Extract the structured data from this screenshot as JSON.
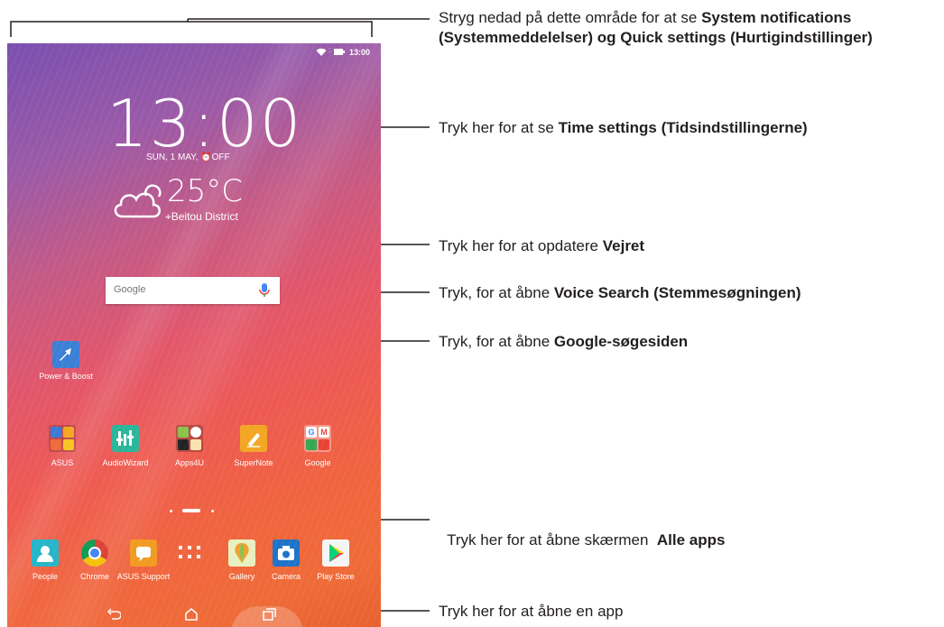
{
  "status_bar": {
    "time": "13:00"
  },
  "clock": {
    "time": "13:00",
    "date": "SUN, 1 MAY, ⏰OFF"
  },
  "weather": {
    "temp": "25°C",
    "location": "⌖Beitou District"
  },
  "search": {
    "brand": "Google"
  },
  "apps": {
    "power_boost": "Power & Boost",
    "row": [
      "ASUS",
      "AudioWizard",
      "Apps4U",
      "SuperNote",
      "Google"
    ],
    "dock": [
      "People",
      "Chrome",
      "ASUS Support",
      "Gallery",
      "Camera",
      "Play Store"
    ]
  },
  "callouts": {
    "c1_a": "Stryg nedad på dette område for at se ",
    "c1_b": "System notifications (Systemmeddelelser) og Quick settings (Hurtigindstillinger)",
    "c2_a": "Tryk her for at se ",
    "c2_b": "Time settings (Tidsindstillingerne)",
    "c3_a": "Tryk her for at opdatere ",
    "c3_b": "Vejret",
    "c4_a": "Tryk, for at åbne ",
    "c4_b": "Voice Search (Stemmesøgningen)",
    "c5_a": "Tryk, for at åbne ",
    "c5_b": "Google-søgesiden",
    "c6_a": "Tryk her for at åbne skærmen  ",
    "c6_b": "Alle apps",
    "c7_a": "Tryk her for at åbne en app"
  }
}
